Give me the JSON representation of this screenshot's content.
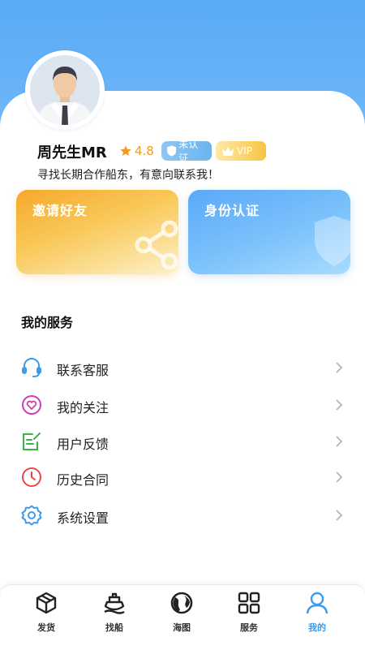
{
  "profile": {
    "name": "周先生MR",
    "rating": "4.8",
    "cert_badge": "未认证",
    "vip_badge": "VIP",
    "bio": "寻找长期合作船东，有意向联系我！"
  },
  "cards": {
    "invite": "邀请好友",
    "identity": "身份认证"
  },
  "services": {
    "title": "我的服务",
    "items": [
      {
        "label": "联系客服",
        "icon": "headset-icon"
      },
      {
        "label": "我的关注",
        "icon": "heart-icon"
      },
      {
        "label": "用户反馈",
        "icon": "feedback-icon"
      },
      {
        "label": "历史合同",
        "icon": "clock-icon"
      },
      {
        "label": "系统设置",
        "icon": "gear-icon"
      }
    ]
  },
  "tabbar": {
    "items": [
      {
        "label": "发货",
        "icon": "package-icon"
      },
      {
        "label": "找船",
        "icon": "ship-icon"
      },
      {
        "label": "海图",
        "icon": "globe-icon"
      },
      {
        "label": "服务",
        "icon": "grid-icon"
      },
      {
        "label": "我的",
        "icon": "user-icon",
        "active": true
      }
    ]
  },
  "colors": {
    "accent": "#3b9bf0",
    "header_blue": "#62b0f6",
    "rating_orange": "#f39a1f"
  }
}
